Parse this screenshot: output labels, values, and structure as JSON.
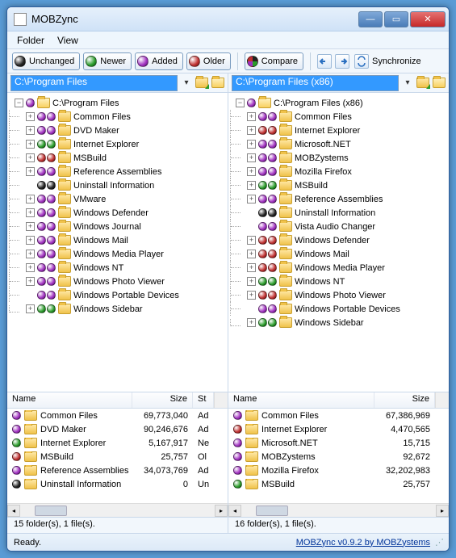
{
  "window": {
    "title": "MOBZync"
  },
  "menu": {
    "folder": "Folder",
    "view": "View"
  },
  "toolbar": {
    "unchanged": "Unchanged",
    "newer": "Newer",
    "added": "Added",
    "older": "Older",
    "compare": "Compare",
    "synchronize": "Synchronize"
  },
  "left": {
    "path": "C:\\Program Files",
    "root": "C:\\Program Files",
    "tree": [
      {
        "balls": [
          "purple",
          "purple"
        ],
        "exp": "+",
        "name": "Common Files"
      },
      {
        "balls": [
          "purple",
          "purple"
        ],
        "exp": "+",
        "name": "DVD Maker"
      },
      {
        "balls": [
          "green",
          "green"
        ],
        "exp": "+",
        "name": "Internet Explorer"
      },
      {
        "balls": [
          "red",
          "red"
        ],
        "exp": "+",
        "name": "MSBuild"
      },
      {
        "balls": [
          "purple",
          "purple"
        ],
        "exp": "+",
        "name": "Reference Assemblies"
      },
      {
        "balls": [
          "black",
          "black"
        ],
        "exp": "",
        "name": "Uninstall Information"
      },
      {
        "balls": [
          "purple",
          "purple"
        ],
        "exp": "+",
        "name": "VMware"
      },
      {
        "balls": [
          "purple",
          "purple"
        ],
        "exp": "+",
        "name": "Windows Defender"
      },
      {
        "balls": [
          "purple",
          "purple"
        ],
        "exp": "+",
        "name": "Windows Journal"
      },
      {
        "balls": [
          "purple",
          "purple"
        ],
        "exp": "+",
        "name": "Windows Mail"
      },
      {
        "balls": [
          "purple",
          "purple"
        ],
        "exp": "+",
        "name": "Windows Media Player"
      },
      {
        "balls": [
          "purple",
          "purple"
        ],
        "exp": "+",
        "name": "Windows NT"
      },
      {
        "balls": [
          "purple",
          "purple"
        ],
        "exp": "+",
        "name": "Windows Photo Viewer"
      },
      {
        "balls": [
          "purple",
          "purple"
        ],
        "exp": "",
        "name": "Windows Portable Devices"
      },
      {
        "balls": [
          "green",
          "green"
        ],
        "exp": "+",
        "name": "Windows Sidebar"
      }
    ],
    "list_header": {
      "name": "Name",
      "size": "Size",
      "st": "St"
    },
    "list": [
      {
        "ball": "purple",
        "name": "Common Files",
        "size": "69,773,040",
        "st": "Ad"
      },
      {
        "ball": "purple",
        "name": "DVD Maker",
        "size": "90,246,676",
        "st": "Ad"
      },
      {
        "ball": "green",
        "name": "Internet Explorer",
        "size": "5,167,917",
        "st": "Ne"
      },
      {
        "ball": "red",
        "name": "MSBuild",
        "size": "25,757",
        "st": "Ol"
      },
      {
        "ball": "purple",
        "name": "Reference Assemblies",
        "size": "34,073,769",
        "st": "Ad"
      },
      {
        "ball": "black",
        "name": "Uninstall Information",
        "size": "0",
        "st": "Un"
      }
    ],
    "status": "15 folder(s), 1 file(s)."
  },
  "right": {
    "path": "C:\\Program Files (x86)",
    "root": "C:\\Program Files (x86)",
    "tree": [
      {
        "balls": [
          "purple",
          "purple"
        ],
        "exp": "+",
        "name": "Common Files"
      },
      {
        "balls": [
          "red",
          "red"
        ],
        "exp": "+",
        "name": "Internet Explorer"
      },
      {
        "balls": [
          "purple",
          "purple"
        ],
        "exp": "+",
        "name": "Microsoft.NET"
      },
      {
        "balls": [
          "purple",
          "purple"
        ],
        "exp": "+",
        "name": "MOBZystems"
      },
      {
        "balls": [
          "purple",
          "purple"
        ],
        "exp": "+",
        "name": "Mozilla Firefox"
      },
      {
        "balls": [
          "green",
          "green"
        ],
        "exp": "+",
        "name": "MSBuild"
      },
      {
        "balls": [
          "purple",
          "purple"
        ],
        "exp": "+",
        "name": "Reference Assemblies"
      },
      {
        "balls": [
          "black",
          "black"
        ],
        "exp": "",
        "name": "Uninstall Information"
      },
      {
        "balls": [
          "purple",
          "purple"
        ],
        "exp": "",
        "name": "Vista Audio Changer"
      },
      {
        "balls": [
          "red",
          "red"
        ],
        "exp": "+",
        "name": "Windows Defender"
      },
      {
        "balls": [
          "red",
          "red"
        ],
        "exp": "+",
        "name": "Windows Mail"
      },
      {
        "balls": [
          "red",
          "red"
        ],
        "exp": "+",
        "name": "Windows Media Player"
      },
      {
        "balls": [
          "green",
          "green"
        ],
        "exp": "+",
        "name": "Windows NT"
      },
      {
        "balls": [
          "red",
          "red"
        ],
        "exp": "+",
        "name": "Windows Photo Viewer"
      },
      {
        "balls": [
          "purple",
          "purple"
        ],
        "exp": "",
        "name": "Windows Portable Devices"
      },
      {
        "balls": [
          "green",
          "green"
        ],
        "exp": "+",
        "name": "Windows Sidebar"
      }
    ],
    "list_header": {
      "name": "Name",
      "size": "Size"
    },
    "list": [
      {
        "ball": "purple",
        "name": "Common Files",
        "size": "67,386,969"
      },
      {
        "ball": "red",
        "name": "Internet Explorer",
        "size": "4,470,565"
      },
      {
        "ball": "purple",
        "name": "Microsoft.NET",
        "size": "15,715"
      },
      {
        "ball": "purple",
        "name": "MOBZystems",
        "size": "92,672"
      },
      {
        "ball": "purple",
        "name": "Mozilla Firefox",
        "size": "32,202,983"
      },
      {
        "ball": "green",
        "name": "MSBuild",
        "size": "25,757"
      }
    ],
    "status": "16 folder(s), 1 file(s)."
  },
  "status": {
    "ready": "Ready.",
    "link": "MOBZync v0.9.2 by MOBZystems"
  }
}
